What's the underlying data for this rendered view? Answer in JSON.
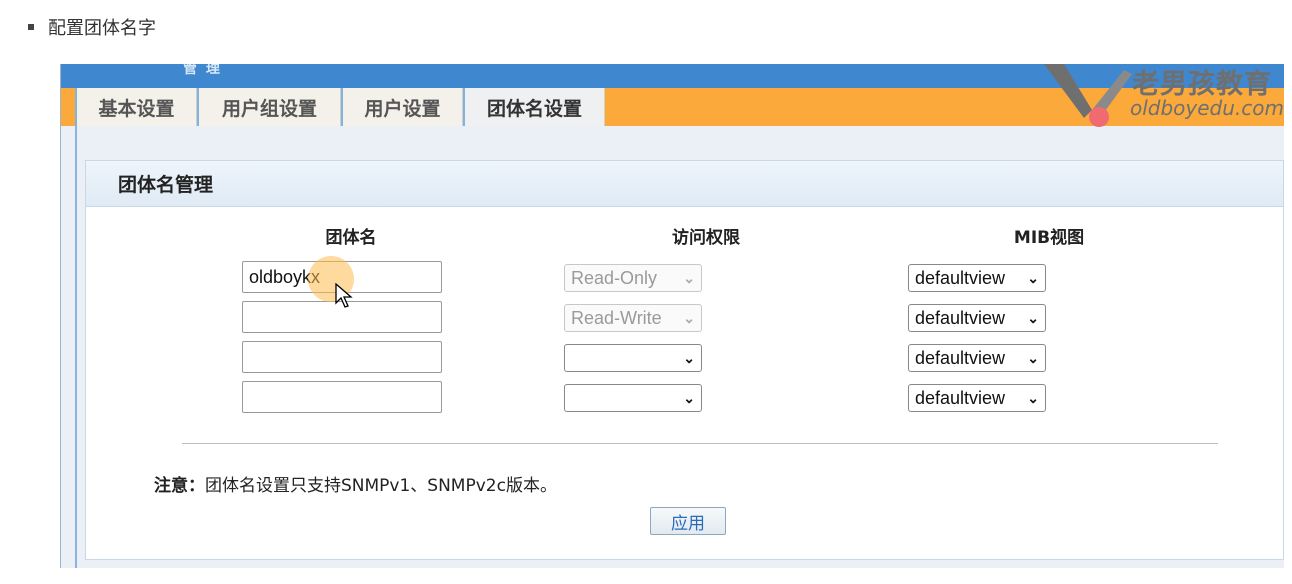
{
  "doc": {
    "bullet_text": "配置团体名字"
  },
  "topbar": {
    "faded_text": "管 理"
  },
  "tabs": [
    {
      "label": "基本设置",
      "active": false
    },
    {
      "label": "用户组设置",
      "active": false
    },
    {
      "label": "用户设置",
      "active": false
    },
    {
      "label": "团体名设置",
      "active": true
    }
  ],
  "panel": {
    "title": "团体名管理",
    "columns": {
      "name": "团体名",
      "access": "访问权限",
      "mib": "MIB视图"
    },
    "rows": [
      {
        "name_value": "oldboykx",
        "access": "Read-Only",
        "access_disabled": true,
        "mib": "defaultview"
      },
      {
        "name_value": "",
        "access": "Read-Write",
        "access_disabled": true,
        "mib": "defaultview"
      },
      {
        "name_value": "",
        "access": "",
        "access_disabled": false,
        "mib": "defaultview"
      },
      {
        "name_value": "",
        "access": "",
        "access_disabled": false,
        "mib": "defaultview"
      }
    ],
    "note_label": "注意：",
    "note_text": "团体名设置只支持SNMPv1、SNMPv2c版本。",
    "apply_label": "应用"
  },
  "watermark": {
    "cn": "老男孩教育",
    "url": "oldboyedu.com"
  },
  "colors": {
    "topbar": "#3f87cf",
    "tabbar": "#fba93a",
    "panel_bg": "#eaf0f6",
    "button_text": "#2a6bb7"
  }
}
